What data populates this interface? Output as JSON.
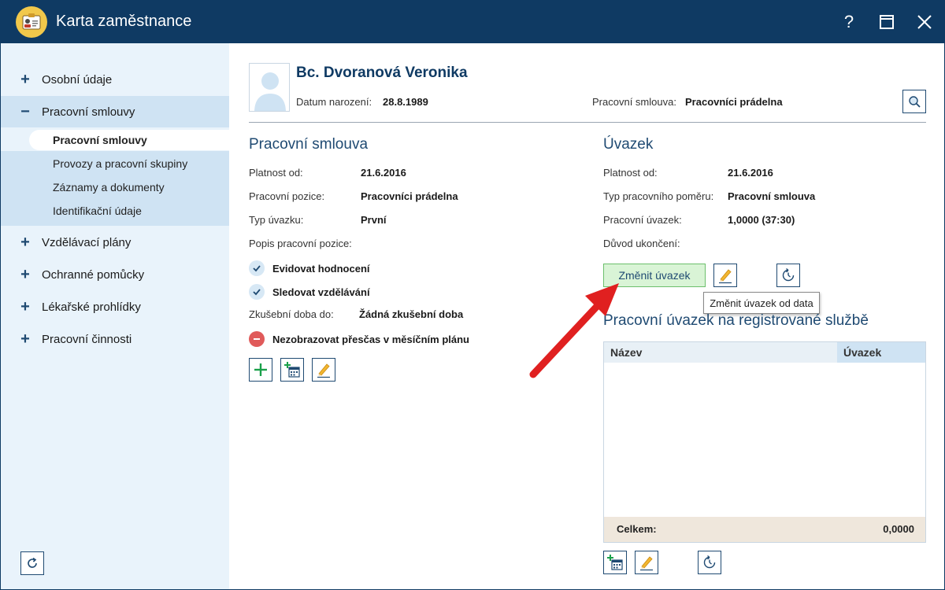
{
  "window": {
    "title": "Karta zaměstnance",
    "help": "?",
    "maximize": "☐",
    "close": "✕"
  },
  "sidebar": {
    "items": [
      {
        "label": "Osobní údaje",
        "sign": "+"
      },
      {
        "label": "Pracovní smlouvy",
        "sign": "−"
      },
      {
        "label": "Vzdělávací plány",
        "sign": "+"
      },
      {
        "label": "Ochranné pomůcky",
        "sign": "+"
      },
      {
        "label": "Lékařské prohlídky",
        "sign": "+"
      },
      {
        "label": "Pracovní činnosti",
        "sign": "+"
      }
    ],
    "subitems": [
      "Pracovní smlouvy",
      "Provozy a pracovní skupiny",
      "Záznamy a dokumenty",
      "Identifikační údaje"
    ]
  },
  "header": {
    "name": "Bc. Dvoranová Veronika",
    "birth_label": "Datum narození:",
    "birth_value": "28.8.1989",
    "contract_label": "Pracovní smlouva:",
    "contract_value": "Pracovníci prádelna"
  },
  "contract": {
    "title": "Pracovní smlouva",
    "valid_from_label": "Platnost od:",
    "valid_from": "21.6.2016",
    "position_label": "Pracovní pozice:",
    "position": "Pracovníci prádelna",
    "type_label": "Typ úvazku:",
    "type": "První",
    "desc_label": "Popis pracovní pozice:",
    "check1": "Evidovat hodnocení",
    "check2": "Sledovat vzdělávání",
    "trial_label": "Zkušební doba do:",
    "trial": "Žádná zkušební doba",
    "overtime": "Nezobrazovat přesčas v měsíčním plánu"
  },
  "workload": {
    "title": "Úvazek",
    "valid_from_label": "Platnost od:",
    "valid_from": "21.6.2016",
    "type_label": "Typ pracovního poměru:",
    "type": "Pracovní smlouva",
    "work_label": "Pracovní úvazek:",
    "work": "1,0000 (37:30)",
    "reason_label": "Důvod ukončení:",
    "change_button": "Změnit úvazek",
    "tooltip": "Změnit úvazek od data"
  },
  "registered": {
    "title": "Pracovní úvazek na registrované službě",
    "col_name": "Název",
    "col_uvazek": "Úvazek",
    "total_label": "Celkem:",
    "total_value": "0,0000"
  },
  "colors": {
    "titlebar": "#0f3a63",
    "sidebar": "#e9f3fb",
    "accent": "#1f4a72",
    "arrow": "#e02020"
  }
}
